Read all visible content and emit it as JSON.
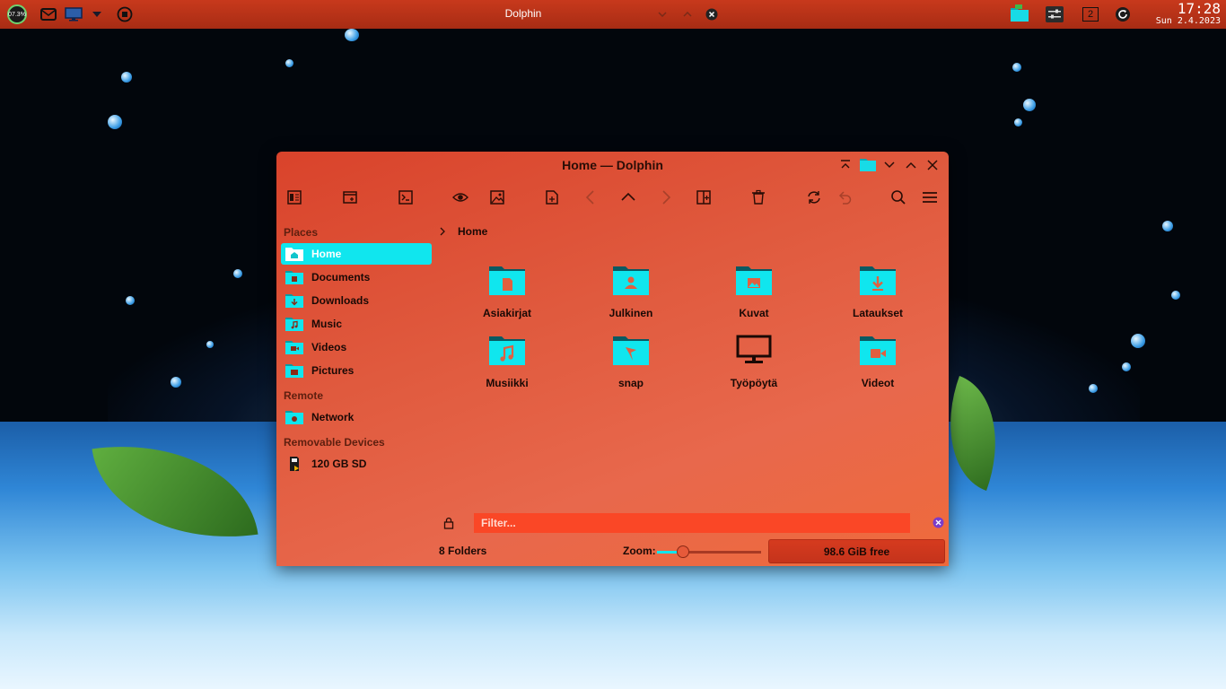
{
  "panel": {
    "cpu_label": "07.3%",
    "title": "Dolphin",
    "workspace": "2",
    "clock_time": "17:28",
    "clock_date": "Sun 2.4.2023"
  },
  "window": {
    "title": "Home — Dolphin"
  },
  "sidebar": {
    "sections": [
      "Places",
      "Remote",
      "Removable Devices"
    ],
    "places": [
      {
        "label": "Home",
        "icon": "home-folder-icon"
      },
      {
        "label": "Documents",
        "icon": "documents-folder-icon"
      },
      {
        "label": "Downloads",
        "icon": "downloads-folder-icon"
      },
      {
        "label": "Music",
        "icon": "music-folder-icon"
      },
      {
        "label": "Videos",
        "icon": "videos-folder-icon"
      },
      {
        "label": "Pictures",
        "icon": "pictures-folder-icon"
      }
    ],
    "remote": [
      {
        "label": "Network",
        "icon": "network-folder-icon"
      }
    ],
    "devices": [
      {
        "label": "120 GB SD",
        "icon": "sd-card-icon"
      }
    ]
  },
  "breadcrumb": {
    "current": "Home"
  },
  "files": [
    {
      "label": "Asiakirjat",
      "icon": "documents-folder-icon"
    },
    {
      "label": "Julkinen",
      "icon": "public-folder-icon"
    },
    {
      "label": "Kuvat",
      "icon": "pictures-folder-icon"
    },
    {
      "label": "Lataukset",
      "icon": "downloads-folder-icon"
    },
    {
      "label": "Musiikki",
      "icon": "music-folder-icon"
    },
    {
      "label": "snap",
      "icon": "snap-folder-icon"
    },
    {
      "label": "Työpöytä",
      "icon": "desktop-monitor-icon"
    },
    {
      "label": "Videot",
      "icon": "videos-folder-icon"
    }
  ],
  "filter": {
    "placeholder": "Filter..."
  },
  "status": {
    "folders": "8 Folders",
    "zoom_label": "Zoom:",
    "zoom_level": 0.25,
    "free_space": "98.6 GiB free"
  },
  "colors": {
    "accent": "#10e6ee",
    "window_bg": "#e05a3e",
    "panel_bg": "#b8321a",
    "filter_bg": "#fa4726"
  }
}
